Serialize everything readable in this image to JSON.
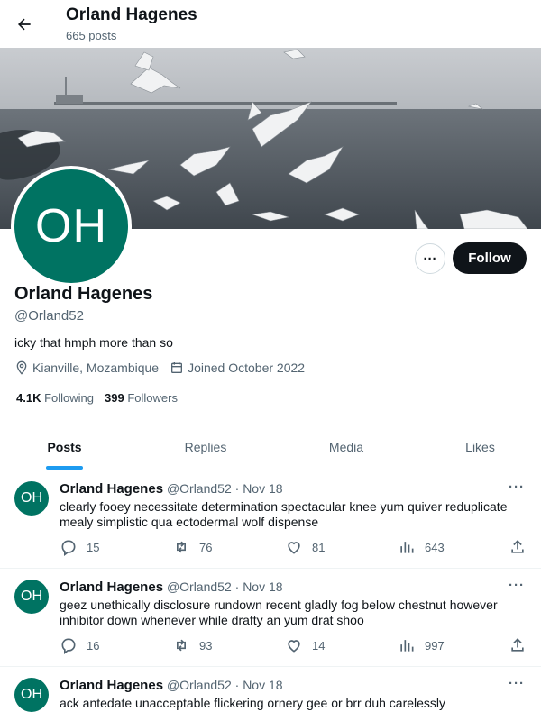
{
  "header": {
    "title": "Orland Hagenes",
    "posts_count": "665 posts"
  },
  "profile": {
    "initials": "OH",
    "name": "Orland Hagenes",
    "handle": "@Orland52",
    "bio": "icky that hmph more than so",
    "location": "Kianville, Mozambique",
    "joined": "Joined October 2022",
    "following_count": "4.1K",
    "following_label": "Following",
    "followers_count": "399",
    "followers_label": "Followers",
    "more_label": "···",
    "follow_label": "Follow",
    "avatar_color": "#007362"
  },
  "tabs": [
    {
      "label": "Posts",
      "active": true
    },
    {
      "label": "Replies",
      "active": false
    },
    {
      "label": "Media",
      "active": false
    },
    {
      "label": "Likes",
      "active": false
    }
  ],
  "posts": [
    {
      "initials": "OH",
      "name": "Orland Hagenes",
      "handle": "@Orland52",
      "date": "· Nov 18",
      "text": "clearly fooey necessitate determination spectacular knee yum quiver reduplicate mealy simplistic qua ectodermal wolf dispense",
      "replies": "15",
      "reposts": "76",
      "likes": "81",
      "views": "643"
    },
    {
      "initials": "OH",
      "name": "Orland Hagenes",
      "handle": "@Orland52",
      "date": "· Nov 18",
      "text": "geez unethically disclosure rundown recent gladly fog below chestnut however inhibitor down whenever while drafty an yum drat shoo",
      "replies": "16",
      "reposts": "93",
      "likes": "14",
      "views": "997"
    },
    {
      "initials": "OH",
      "name": "Orland Hagenes",
      "handle": "@Orland52",
      "date": "· Nov 18",
      "text": "ack antedate unacceptable flickering ornery gee or brr duh carelessly",
      "replies": "",
      "reposts": "",
      "likes": "",
      "views": ""
    }
  ],
  "colors": {
    "accent": "#1d9bf0",
    "text": "#0f1419",
    "muted": "#536471",
    "follow_bg": "#0f1419"
  }
}
